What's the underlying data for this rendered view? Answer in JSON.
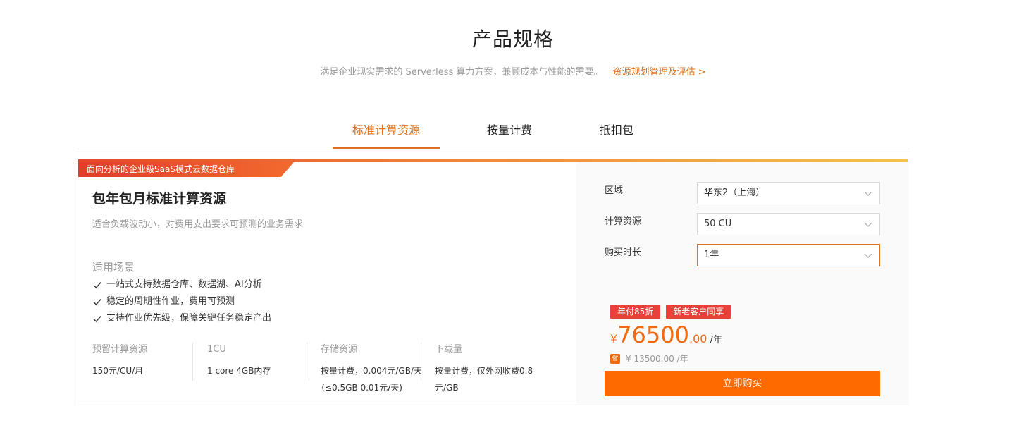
{
  "header": {
    "title": "产品规格",
    "subtitle": "满足企业现实需求的 Serverless 算力方案，兼顾成本与性能的需要。",
    "link": "资源规划管理及评估 >"
  },
  "tabs": [
    {
      "label": "标准计算资源",
      "active": true
    },
    {
      "label": "按量计费",
      "active": false
    },
    {
      "label": "抵扣包",
      "active": false
    }
  ],
  "card": {
    "ribbon": "面向分析的企业级SaaS模式云数据仓库",
    "plan_title": "包年包月标准计算资源",
    "plan_desc": "适合负载波动小，对费用支出要求可预测的业务需求",
    "scenarios_title": "适用场景",
    "scenarios": [
      "一站式支持数据仓库、数据湖、AI分析",
      "稳定的周期性作业，费用可预测",
      "支持作业优先级，保障关键任务稳定产出"
    ],
    "specs": [
      {
        "label": "预留计算资源",
        "value": "150元/CU/月"
      },
      {
        "label": "1CU",
        "value": "1 core 4GB内存"
      },
      {
        "label": "存储资源",
        "value": "按量计费，0.004元/GB/天",
        "value2": "（≤0.5GB 0.01元/天)"
      },
      {
        "label": "下载量",
        "value": "按量计费，仅外网收费0.8",
        "value2": "元/GB"
      }
    ]
  },
  "config": {
    "region_label": "区域",
    "region_value": "华东2（上海）",
    "compute_label": "计算资源",
    "compute_value": "50 CU",
    "duration_label": "购买时长",
    "duration_value": "1年"
  },
  "pricing": {
    "badges": [
      "年付85折",
      "新老客户同享"
    ],
    "currency": "¥",
    "price_int": "76500",
    "price_dec": ".00",
    "price_unit": "/年",
    "save_icon": "省",
    "save_text": "¥ 13500.00 /年",
    "buy_label": "立即购买"
  },
  "colors": {
    "accent": "#e0701a",
    "button": "#ff6a00",
    "badge": "#e8403a"
  }
}
